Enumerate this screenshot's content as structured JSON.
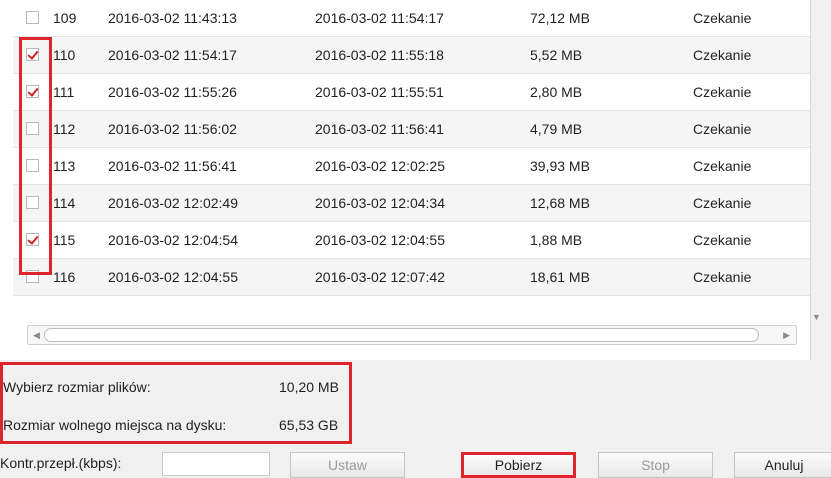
{
  "rows": [
    {
      "id": "109",
      "start": "2016-03-02 11:43:13",
      "end": "2016-03-02 11:54:17",
      "size": "72,12 MB",
      "status": "Czekanie",
      "checked": false
    },
    {
      "id": "110",
      "start": "2016-03-02 11:54:17",
      "end": "2016-03-02 11:55:18",
      "size": "5,52 MB",
      "status": "Czekanie",
      "checked": true
    },
    {
      "id": "111",
      "start": "2016-03-02 11:55:26",
      "end": "2016-03-02 11:55:51",
      "size": "2,80 MB",
      "status": "Czekanie",
      "checked": true
    },
    {
      "id": "112",
      "start": "2016-03-02 11:56:02",
      "end": "2016-03-02 11:56:41",
      "size": "4,79 MB",
      "status": "Czekanie",
      "checked": false
    },
    {
      "id": "113",
      "start": "2016-03-02 11:56:41",
      "end": "2016-03-02 12:02:25",
      "size": "39,93 MB",
      "status": "Czekanie",
      "checked": false
    },
    {
      "id": "114",
      "start": "2016-03-02 12:02:49",
      "end": "2016-03-02 12:04:34",
      "size": "12,68 MB",
      "status": "Czekanie",
      "checked": false
    },
    {
      "id": "115",
      "start": "2016-03-02 12:04:54",
      "end": "2016-03-02 12:04:55",
      "size": "1,88 MB",
      "status": "Czekanie",
      "checked": true
    },
    {
      "id": "116",
      "start": "2016-03-02 12:04:55",
      "end": "2016-03-02 12:07:42",
      "size": "18,61 MB",
      "status": "Czekanie",
      "checked": false
    }
  ],
  "info": {
    "selected_label": "Wybierz rozmiar plików:",
    "selected_value": "10,20 MB",
    "free_label": "Rozmiar wolnego miejsca na dysku:",
    "free_value": "65,53 GB"
  },
  "bottom": {
    "kontr_label": "Kontr.przepł.(kbps):",
    "kontr_value": "",
    "ustaw_label": "Ustaw",
    "pobierz_label": "Pobierz",
    "stop_label": "Stop",
    "anuluj_label": "Anuluj"
  },
  "colors": {
    "highlight": "#e0242c",
    "check": "#d42020"
  }
}
